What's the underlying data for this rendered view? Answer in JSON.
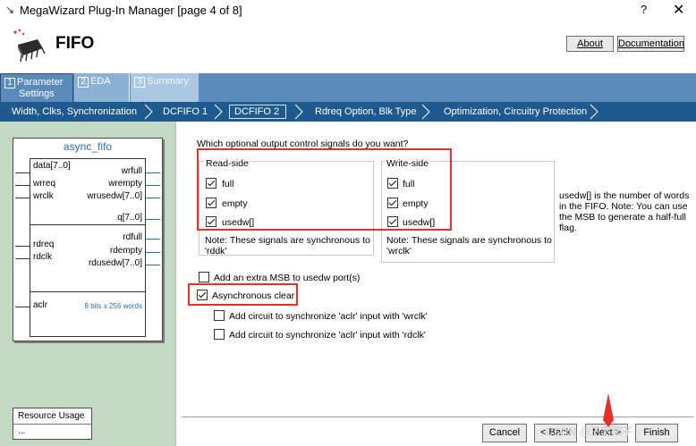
{
  "window": {
    "title": "MegaWizard Plug-In Manager [page 4 of 8]",
    "help": "?",
    "close": "✕"
  },
  "header": {
    "title": "FIFO",
    "about": "About",
    "documentation": "Documentation"
  },
  "tabs": [
    {
      "num": "1",
      "label_line1": "Parameter",
      "label_line2": "Settings"
    },
    {
      "num": "2",
      "label": "EDA"
    },
    {
      "num": "3",
      "label": "Summary"
    }
  ],
  "breadcrumb": [
    "Width, Clks, Synchronization",
    "DCFIFO 1",
    "DCFIFO 2",
    "Rdreq Option, Blk Type",
    "Optimization, Circuitry Protection"
  ],
  "symbol": {
    "title": "async_fifo",
    "left_pins": [
      "data[7..0]",
      "wrreq",
      "wrclk",
      "rdreq",
      "rdclk",
      "aclr"
    ],
    "right_pins": [
      "wrfull",
      "wrempty",
      "wrusedw[7..0]",
      "q[7..0]",
      "rdfull",
      "rdempty",
      "rdusedw[7..0]"
    ],
    "size_note": "8 bits x 256 words"
  },
  "resource": {
    "title": "Resource Usage",
    "value": "..."
  },
  "form": {
    "question": "Which optional output control signals do you want?",
    "read_side": {
      "title": "Read-side",
      "full": "full",
      "empty": "empty",
      "usedw": "usedw[]",
      "note": "Note: These signals are synchronous to 'rddk'"
    },
    "write_side": {
      "title": "Write-side",
      "full": "full",
      "empty": "empty",
      "usedw": "usedw[]",
      "note": "Note: These signals are synchronous to 'wrclk'"
    },
    "side_note": "usedw[] is the number of words in the FIFO. Note: You can use the MSB to generate a half-full flag.",
    "extra_msb": "Add an extra MSB to usedw port(s)",
    "async_clear": "Asynchronous clear",
    "sync_wrclk": "Add circuit to synchronize 'aclr' input with 'wrclk'",
    "sync_rdclk": "Add circuit to synchronize 'aclr' input with 'rdclk'"
  },
  "footer": {
    "cancel": "Cancel",
    "back": "< Back",
    "next": "Next >",
    "finish": "Finish",
    "watermark": "CSDN @王宗阳子"
  }
}
